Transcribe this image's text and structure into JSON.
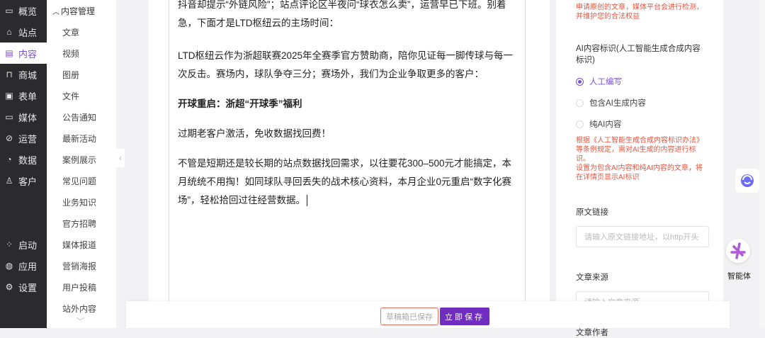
{
  "nav": {
    "items": [
      {
        "label": "概览",
        "icon": "monitor-icon"
      },
      {
        "label": "站点",
        "icon": "home-icon"
      },
      {
        "label": "内容",
        "icon": "document-icon"
      },
      {
        "label": "商城",
        "icon": "shop-icon"
      },
      {
        "label": "表单",
        "icon": "form-icon"
      },
      {
        "label": "媒体",
        "icon": "video-icon"
      },
      {
        "label": "运营",
        "icon": "paperclip-icon"
      },
      {
        "label": "数据",
        "icon": "pie-chart-icon"
      },
      {
        "label": "客户",
        "icon": "user-icon"
      }
    ],
    "bottom": [
      {
        "label": "启动",
        "icon": "launch-dots-icon"
      },
      {
        "label": "应用",
        "icon": "apps-ring-icon"
      },
      {
        "label": "设置",
        "icon": "gear-icon"
      }
    ]
  },
  "submenu": {
    "title": "内容管理",
    "items": [
      "文章",
      "视频",
      "图册",
      "文件",
      "公告通知",
      "最新活动",
      "案例展示",
      "常见问题",
      "业务知识",
      "官方招聘",
      "媒体报道",
      "营销海报",
      "用户投稿",
      "站外内容"
    ]
  },
  "editor": {
    "p1": "抖音却提示“外链风险”；站点评论区半夜问“球衣怎么卖”，运营早已下班。别着急，下面才是LTD枢纽云的主场时间：",
    "p2": "LTD枢纽云作为浙超联赛2025年全赛季官方赞助商，陪你见证每一脚传球与每一次反击。赛场内，球队争夺三分；赛场外，我们为企业争取更多的客户：",
    "p3": "开球重启：浙超“开球季”福利",
    "p4": "过期老客户激活，免收数据找回费！",
    "p5": "不管是短期还是较长期的站点数据找回需求，以往要花300–500元才能搞定，本月统统不用掏！如同球队寻回丢失的战术核心资料，本月企业0元重启“数字化赛场”，轻松拾回过往经营数据。"
  },
  "panel": {
    "original_note": "申请原创的文章，媒体平台会进行检测，并维护您的合法权益",
    "ai_label": "AI内容标识(人工智能生成合成内容标识)",
    "ai_options": [
      "人工编写",
      "包含AI生成内容",
      "纯AI内容"
    ],
    "ai_selected": "人工编写",
    "ai_note1": "根据《人工智能生成合成内容标识办法》等条例规定，需对AI生成的内容进行标识。",
    "ai_note2": "设置为包含AI内容和纯AI内容的文章，将在详情页显示AI标识",
    "source_link_label": "原文链接",
    "source_link_placeholder": "请输入原文链接地址，以http开头",
    "source_label": "文章来源",
    "source_placeholder": "请输入文章来源",
    "author_label": "文章作者"
  },
  "footer": {
    "draft_status": "草稿箱已保存",
    "save_label": "立即保存"
  },
  "floating": {
    "agent_label": "智能体"
  },
  "colors": {
    "accent": "#6f2ec0",
    "warn": "#e8543e",
    "nav_bg": "#2b2b2d"
  }
}
